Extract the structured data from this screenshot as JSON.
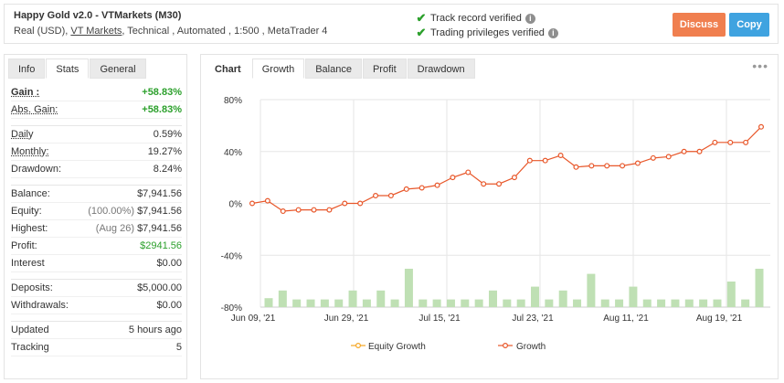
{
  "header": {
    "title": "Happy Gold v2.0 - VTMarkets (M30)",
    "account_type": "Real (USD),",
    "broker": "VT Markets",
    "details": ", Technical , Automated , 1:500 , MetaTrader 4",
    "verify1": "Track record verified",
    "verify2": "Trading privileges verified",
    "discuss_label": "Discuss",
    "copy_label": "Copy"
  },
  "left_tabs": [
    "Info",
    "Stats",
    "General"
  ],
  "stats": {
    "gain_label": "Gain :",
    "gain": "+58.83%",
    "abs_gain_label": "Abs. Gain:",
    "abs_gain": "+58.83%",
    "daily_label": "Daily",
    "daily": "0.59%",
    "monthly_label": "Monthly:",
    "monthly": "19.27%",
    "drawdown_label": "Drawdown:",
    "drawdown": "8.24%",
    "balance_label": "Balance:",
    "balance": "$7,941.56",
    "equity_label": "Equity:",
    "equity_note": "(100.00%)",
    "equity": "$7,941.56",
    "highest_label": "Highest:",
    "highest_note": "(Aug 26)",
    "highest": "$7,941.56",
    "profit_label": "Profit:",
    "profit": "$2941.56",
    "interest_label": "Interest",
    "interest": "$0.00",
    "deposits_label": "Deposits:",
    "deposits": "$5,000.00",
    "withdrawals_label": "Withdrawals:",
    "withdrawals": "$0.00",
    "updated_label": "Updated",
    "updated": "5 hours ago",
    "tracking_label": "Tracking",
    "tracking": "5"
  },
  "right_tabs": [
    "Chart",
    "Growth",
    "Balance",
    "Profit",
    "Drawdown"
  ],
  "menu_dots": "•••",
  "colors": {
    "growth": "#e8572a",
    "equity": "#f5a623",
    "bars": "#bfe0b4",
    "green": "#2ca02c",
    "discuss": "#f07f4f",
    "copy": "#3fa3e0"
  },
  "chart_data": {
    "type": "line",
    "y_tick_labels": [
      "80%",
      "40%",
      "0%",
      "-40%",
      "-80%"
    ],
    "ylim": [
      -80,
      80
    ],
    "x_tick_labels": [
      "Jun 09, '21",
      "Jun 29, '21",
      "Jul 15, '21",
      "Jul 23, '21",
      "Aug 11, '21",
      "Aug 19, '21"
    ],
    "series": [
      {
        "name": "Equity Growth",
        "values": []
      },
      {
        "name": "Growth",
        "values": [
          0,
          2,
          -6,
          -5,
          -5,
          -5,
          0,
          0,
          6,
          6,
          11,
          12,
          14,
          20,
          24,
          15,
          15,
          20,
          33,
          33,
          37,
          28,
          29,
          29,
          29,
          31,
          35,
          36,
          40,
          40,
          47,
          47,
          47,
          59
        ]
      },
      {
        "name": "",
        "type": "bar",
        "values": [
          7,
          13,
          6,
          6,
          6,
          6,
          13,
          6,
          13,
          6,
          30,
          6,
          6,
          6,
          6,
          6,
          13,
          6,
          6,
          16,
          6,
          13,
          6,
          26,
          6,
          6,
          16,
          6,
          6,
          6,
          6,
          6,
          6,
          20,
          6,
          30
        ]
      }
    ]
  }
}
